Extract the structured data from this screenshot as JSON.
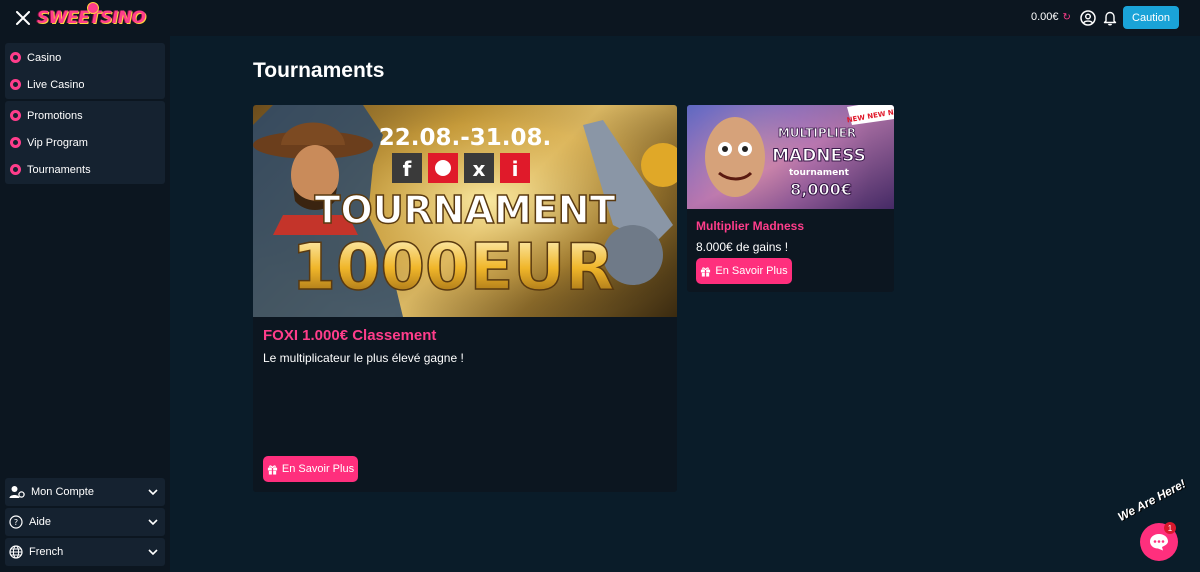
{
  "header": {
    "logo_text": "SWEETSINO",
    "balance": "0.00€",
    "deposit_label": "Caution"
  },
  "sidebar": {
    "group1": [
      {
        "label": "Casino",
        "icon": "casino-chip-icon"
      },
      {
        "label": "Live Casino",
        "icon": "live-casino-icon"
      }
    ],
    "group2": [
      {
        "label": "Promotions",
        "icon": "promotions-icon"
      },
      {
        "label": "Vip Program",
        "icon": "vip-icon"
      },
      {
        "label": "Tournaments",
        "icon": "tournaments-icon"
      }
    ],
    "bottom": [
      {
        "label": "Mon Compte",
        "icon": "account-settings-icon"
      },
      {
        "label": "Aide",
        "icon": "help-icon"
      },
      {
        "label": "French",
        "icon": "globe-icon"
      }
    ]
  },
  "main": {
    "title": "Tournaments",
    "cards": [
      {
        "title": "FOXI 1.000€ Classement",
        "description": "Le multiplicateur le plus élevé gagne !",
        "button": "En Savoir Plus",
        "banner": {
          "dates": "22.08.-31.08.",
          "social": [
            "f",
            "x",
            "i"
          ],
          "headline": "TOURNAMENT",
          "prize": "1000EUR"
        }
      },
      {
        "title": "Multiplier Madness",
        "description": "8.000€ de gains !",
        "button": "En Savoir Plus",
        "banner": {
          "ribbon": "NEW NEW NE",
          "line1": "MULTIPLIER",
          "line2": "MADNESS",
          "line3": "tournament",
          "prize": "8,000€"
        }
      }
    ]
  },
  "chat": {
    "tagline": "We Are Here!",
    "badge_count": "1"
  },
  "colors": {
    "accent_pink": "#ff2f7d",
    "brand_blue": "#1aa3d8",
    "background": "#0a1c29",
    "panel": "#0c1620"
  }
}
